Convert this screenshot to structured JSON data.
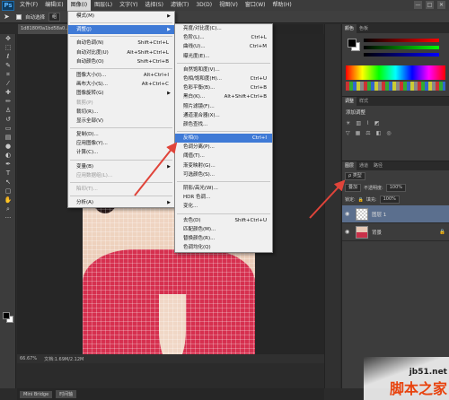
{
  "app": {
    "logo_text": "Ps",
    "doc_tab": "1d8180f0a1bd58a0..."
  },
  "menubar": {
    "items": [
      "文件(F)",
      "编辑(E)",
      "图像(I)",
      "图层(L)",
      "文字(Y)",
      "选择(S)",
      "滤镜(T)",
      "3D(D)",
      "视图(V)",
      "窗口(W)",
      "帮助(H)"
    ],
    "active_index": 2,
    "window_controls": [
      "—",
      "□",
      "✕"
    ]
  },
  "optionsbar": {
    "auto_select_label": "自动选择",
    "auto_select_value": "组"
  },
  "image_menu": {
    "items": [
      {
        "label": "模式(M)",
        "shortcut": "",
        "submenu": true
      },
      {
        "sep": true
      },
      {
        "label": "调整(J)",
        "shortcut": "",
        "submenu": true,
        "highlight": true
      },
      {
        "sep": true
      },
      {
        "label": "自动色调(N)",
        "shortcut": "Shift+Ctrl+L"
      },
      {
        "label": "自动对比度(U)",
        "shortcut": "Alt+Shift+Ctrl+L"
      },
      {
        "label": "自动颜色(O)",
        "shortcut": "Shift+Ctrl+B"
      },
      {
        "sep": true
      },
      {
        "label": "图像大小(I)...",
        "shortcut": "Alt+Ctrl+I"
      },
      {
        "label": "画布大小(S)...",
        "shortcut": "Alt+Ctrl+C"
      },
      {
        "label": "图像旋转(G)",
        "shortcut": "",
        "submenu": true
      },
      {
        "label": "裁剪(P)",
        "shortcut": "",
        "disabled": true
      },
      {
        "label": "裁切(R)...",
        "shortcut": ""
      },
      {
        "label": "显示全部(V)",
        "shortcut": ""
      },
      {
        "sep": true
      },
      {
        "label": "复制(D)...",
        "shortcut": ""
      },
      {
        "label": "应用图像(Y)...",
        "shortcut": ""
      },
      {
        "label": "计算(C)...",
        "shortcut": ""
      },
      {
        "sep": true
      },
      {
        "label": "变量(B)",
        "shortcut": "",
        "submenu": true
      },
      {
        "label": "应用数据组(L)...",
        "shortcut": "",
        "disabled": true
      },
      {
        "sep": true
      },
      {
        "label": "陷印(T)...",
        "shortcut": "",
        "disabled": true
      },
      {
        "sep": true
      },
      {
        "label": "分析(A)",
        "shortcut": "",
        "submenu": true
      }
    ]
  },
  "adjust_menu": {
    "items": [
      {
        "label": "亮度/对比度(C)...",
        "shortcut": ""
      },
      {
        "label": "色阶(L)...",
        "shortcut": "Ctrl+L"
      },
      {
        "label": "曲线(U)...",
        "shortcut": "Ctrl+M"
      },
      {
        "label": "曝光度(E)...",
        "shortcut": ""
      },
      {
        "sep": true
      },
      {
        "label": "自然饱和度(V)...",
        "shortcut": ""
      },
      {
        "label": "色相/饱和度(H)...",
        "shortcut": "Ctrl+U"
      },
      {
        "label": "色彩平衡(B)...",
        "shortcut": "Ctrl+B"
      },
      {
        "label": "黑白(K)...",
        "shortcut": "Alt+Shift+Ctrl+B"
      },
      {
        "label": "照片滤镜(F)...",
        "shortcut": ""
      },
      {
        "label": "通道混合器(X)...",
        "shortcut": ""
      },
      {
        "label": "颜色查找...",
        "shortcut": ""
      },
      {
        "sep": true
      },
      {
        "label": "反相(I)",
        "shortcut": "Ctrl+I",
        "highlight": true
      },
      {
        "label": "色调分离(P)...",
        "shortcut": ""
      },
      {
        "label": "阈值(T)...",
        "shortcut": ""
      },
      {
        "label": "渐变映射(G)...",
        "shortcut": ""
      },
      {
        "label": "可选颜色(S)...",
        "shortcut": ""
      },
      {
        "sep": true
      },
      {
        "label": "阴影/高光(W)...",
        "shortcut": ""
      },
      {
        "label": "HDR 色调...",
        "shortcut": ""
      },
      {
        "label": "变化...",
        "shortcut": ""
      },
      {
        "sep": true
      },
      {
        "label": "去色(D)",
        "shortcut": "Shift+Ctrl+U"
      },
      {
        "label": "匹配颜色(M)...",
        "shortcut": ""
      },
      {
        "label": "替换颜色(R)...",
        "shortcut": ""
      },
      {
        "label": "色调均化(Q)",
        "shortcut": ""
      }
    ]
  },
  "status": {
    "zoom": "66.67%",
    "doc": "文档:1.69M/2.12M"
  },
  "bottom_tabs": [
    "Mini Bridge",
    "时间轴"
  ],
  "panels": {
    "color_tabs": [
      "颜色",
      "色板"
    ],
    "adjust_tabs": [
      "调整",
      "样式"
    ],
    "adjust_title": "添加调整",
    "layer_tabs": [
      "图层",
      "通道",
      "路径"
    ],
    "kind_label": "ρ 类型",
    "blend_mode": "叠加",
    "opacity_label": "不透明度:",
    "opacity_value": "100%",
    "lock_label": "锁定:",
    "fill_label": "填充:",
    "fill_value": "100%",
    "layers": [
      {
        "name": "图层 1",
        "selected": true
      },
      {
        "name": "背景",
        "selected": false
      }
    ]
  },
  "watermark": {
    "site": "jb51.net",
    "cn": "脚本之家"
  },
  "colors": {
    "highlight": "#3f7ad6",
    "arrow": "#e0443a",
    "dress": "#d6304f"
  }
}
